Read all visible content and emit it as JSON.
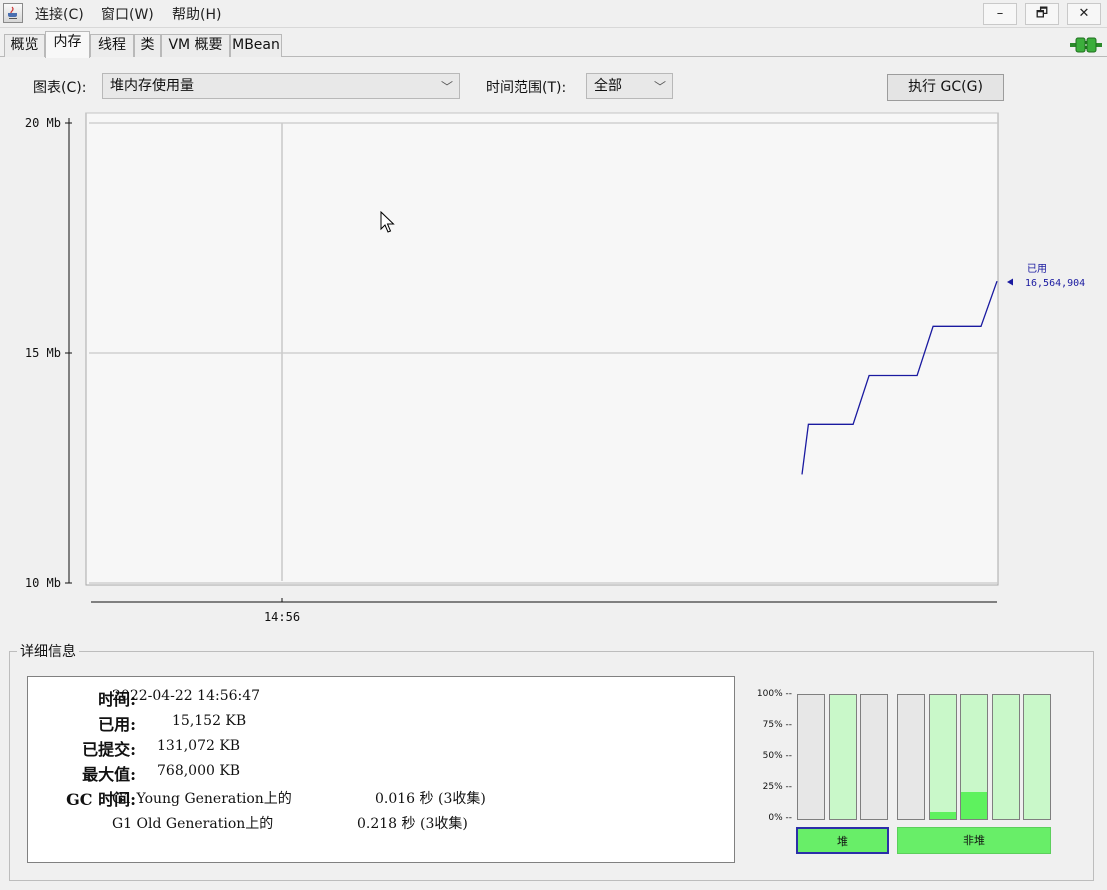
{
  "menu": {
    "connect": "连接(C)",
    "window": "窗口(W)",
    "help": "帮助(H)"
  },
  "window_buttons": {
    "minimize": "–",
    "restore": "🗗",
    "close": "✕"
  },
  "tabs": [
    {
      "label": "概览",
      "active": false
    },
    {
      "label": "内存",
      "active": true
    },
    {
      "label": "线程",
      "active": false
    },
    {
      "label": "类",
      "active": false
    },
    {
      "label": "VM 概要",
      "active": false
    },
    {
      "label": "MBean",
      "active": false
    }
  ],
  "controls": {
    "chart_label": "图表(C):",
    "chart_value": "堆内存使用量",
    "range_label": "时间范围(T):",
    "range_value": "全部",
    "gc_button": "执行 GC(G)"
  },
  "chart_data": {
    "type": "line",
    "y_tick_labels": [
      "20 Mb",
      "15 Mb",
      "10 Mb"
    ],
    "y_ticks": [
      20,
      15,
      10
    ],
    "ylim": [
      10,
      20
    ],
    "x_tick_labels": [
      "14:56"
    ],
    "series": [
      {
        "name": "已用",
        "color": "#1a1aa0",
        "value_label": "16,564,904",
        "points": [
          [
            0,
            12.36
          ],
          [
            0.02,
            13.45
          ],
          [
            0.16,
            13.45
          ],
          [
            0.21,
            14.51
          ],
          [
            0.36,
            14.51
          ],
          [
            0.41,
            15.58
          ],
          [
            0.56,
            15.58
          ],
          [
            0.61,
            16.56
          ]
        ]
      }
    ]
  },
  "details": {
    "legend": "详细信息",
    "time_label": "时间:",
    "time_value": "2022-04-22 14:56:47",
    "used_label": "已用:",
    "used_value": "15,152 KB",
    "committed_label": "已提交:",
    "committed_value": "131,072 KB",
    "max_label": "最大值:",
    "max_value": "768,000 KB",
    "gc_label": "GC 时间:",
    "gc_young_name": "G1 Young Generation上的",
    "gc_young_value": "0.016 秒 (3收集)",
    "gc_old_name": "G1 Old Generation上的",
    "gc_old_value": "0.218 秒 (3收集)"
  },
  "pools": {
    "pct_labels": [
      "100% --",
      "75% --",
      "50% --",
      "25% --",
      "0% --"
    ],
    "heap_button": "堆",
    "nonheap_button": "非堆",
    "heap_bars": [
      {
        "committed": 0,
        "used": 0
      },
      {
        "committed": 1,
        "used": 0
      },
      {
        "committed": 0,
        "used": 0
      }
    ],
    "nonheap_bars": [
      {
        "committed": 0,
        "used": 0
      },
      {
        "committed": 1,
        "used": 0.06
      },
      {
        "committed": 1,
        "used": 0.22
      },
      {
        "committed": 1,
        "used": 0
      },
      {
        "committed": 1,
        "used": 0
      }
    ]
  }
}
